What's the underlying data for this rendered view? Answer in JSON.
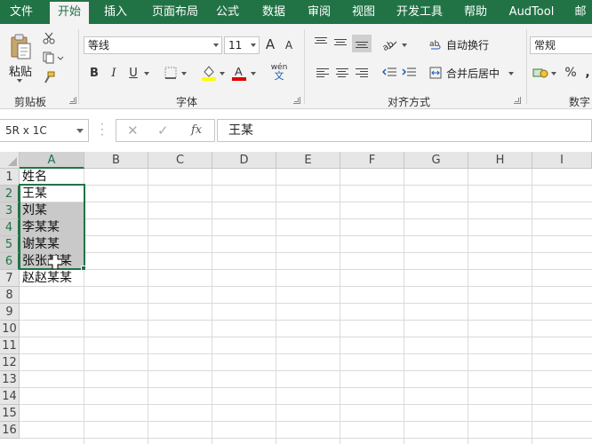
{
  "tabs": [
    "文件",
    "开始",
    "插入",
    "页面布局",
    "公式",
    "数据",
    "审阅",
    "视图",
    "开发工具",
    "帮助",
    "AudTool",
    "邮"
  ],
  "active_tab": "开始",
  "ribbon": {
    "clipboard": {
      "paste_label": "粘贴",
      "group_label": "剪贴板"
    },
    "font": {
      "font_name": "等线",
      "font_size": "11",
      "grow": "A",
      "shrink": "A",
      "bold": "B",
      "italic": "I",
      "underline": "U",
      "group_label": "字体",
      "phonetic": "wén"
    },
    "alignment": {
      "wrap_text": "自动换行",
      "merge_center": "合并后居中",
      "group_label": "对齐方式"
    },
    "number": {
      "format": "常规",
      "percent": "%",
      "group_label": "数字"
    }
  },
  "formula_bar": {
    "name_box": "5R x 1C",
    "fx": "fx",
    "content": "王某"
  },
  "columns": [
    "A",
    "B",
    "C",
    "D",
    "E",
    "F",
    "G",
    "H",
    "I"
  ],
  "rows": [
    "1",
    "2",
    "3",
    "4",
    "5",
    "6",
    "7",
    "8",
    "9",
    "10",
    "11",
    "12",
    "13",
    "14",
    "15",
    "16"
  ],
  "cells": {
    "A1": "姓名",
    "A2": "王某",
    "A3": "刘某",
    "A4": "李某某",
    "A5": "谢某某",
    "A6": "张张某某",
    "A7": "赵赵某某"
  },
  "colors": {
    "accent": "#217346",
    "selection_fill": "#c9c9c9"
  }
}
